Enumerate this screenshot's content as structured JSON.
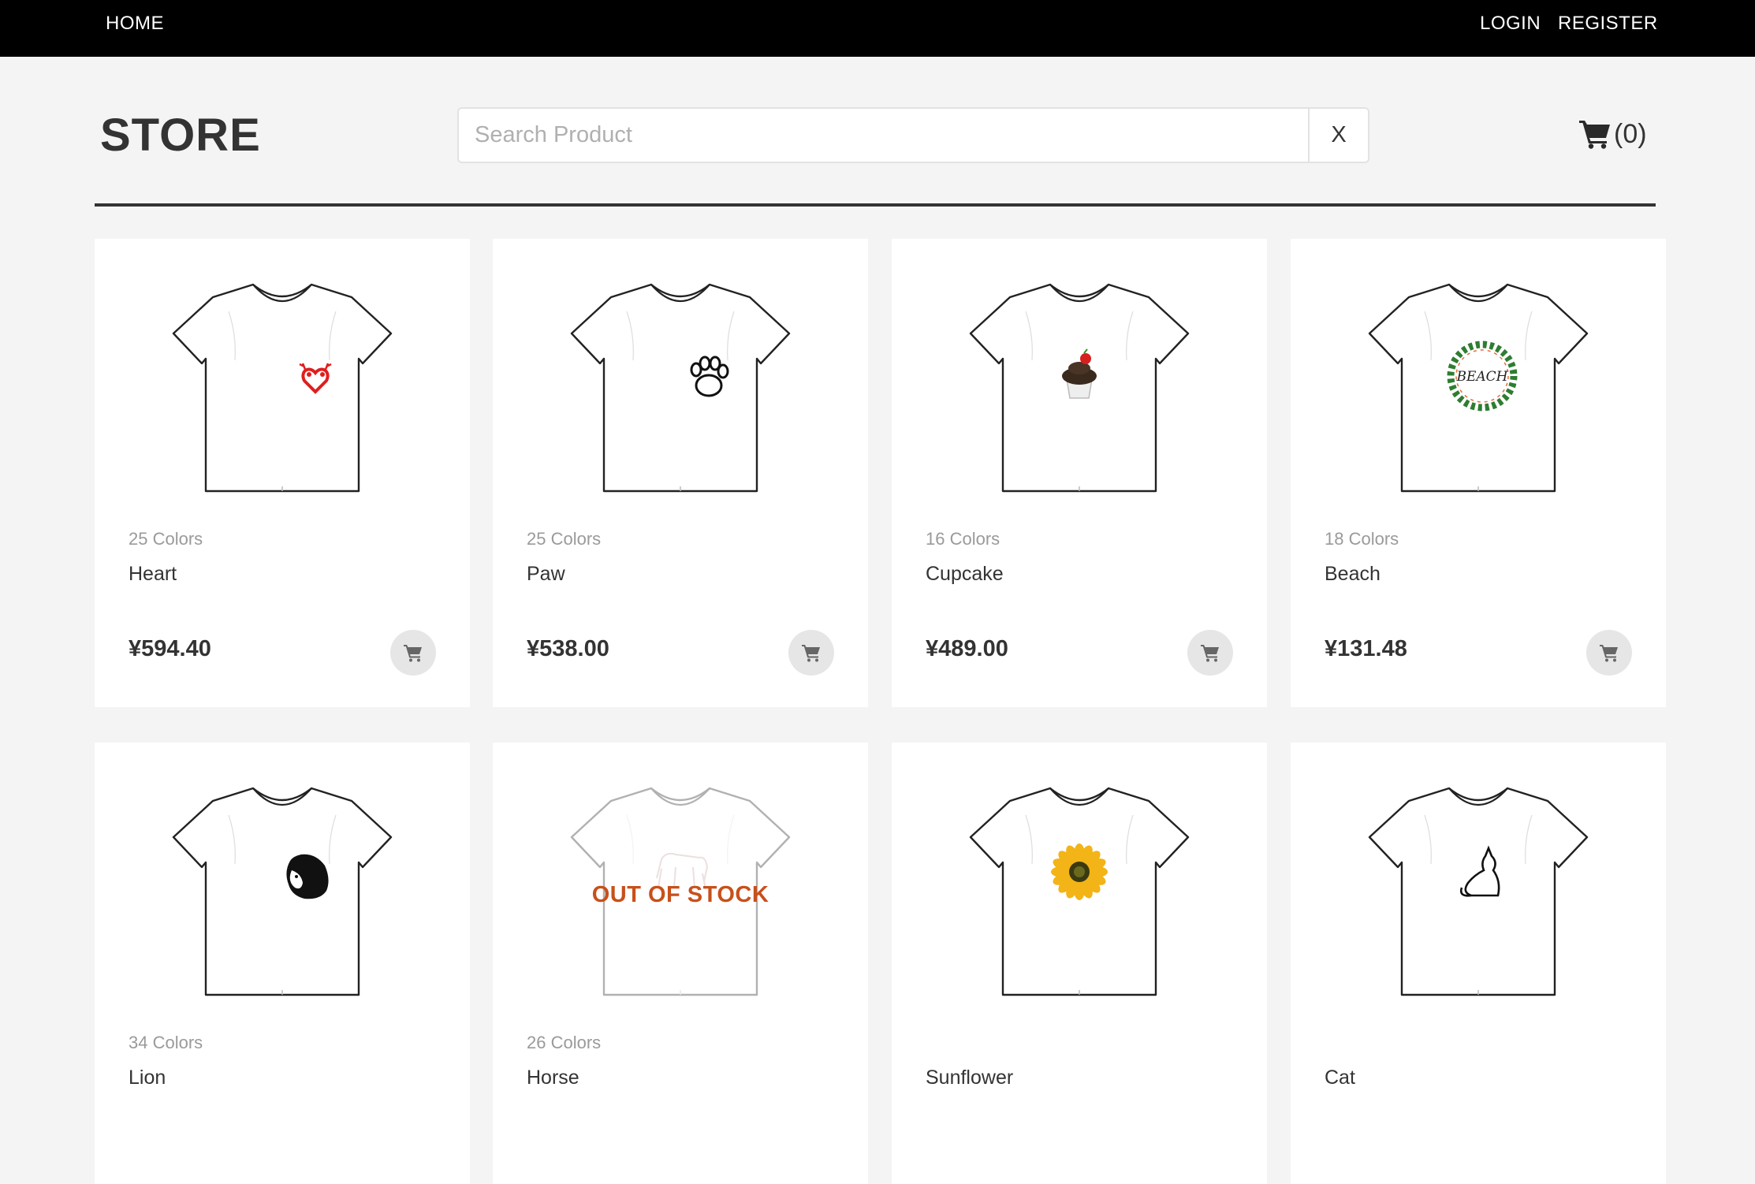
{
  "nav": {
    "home": "HOME",
    "login": "LOGIN",
    "register": "REGISTER"
  },
  "header": {
    "title": "STORE",
    "search_placeholder": "Search Product",
    "search_value": "",
    "clear_label": "X",
    "cart_count": "(0)"
  },
  "products": [
    {
      "colors": "25 Colors",
      "name": "Heart",
      "price": "¥594.40",
      "design": "heart-deer-icon",
      "in_stock": true
    },
    {
      "colors": "25 Colors",
      "name": "Paw",
      "price": "¥538.00",
      "design": "paw-icon",
      "in_stock": true
    },
    {
      "colors": "16 Colors",
      "name": "Cupcake",
      "price": "¥489.00",
      "design": "cupcake-icon",
      "in_stock": true
    },
    {
      "colors": "18 Colors",
      "name": "Beach",
      "price": "¥131.48",
      "design": "beach-wreath-icon",
      "design_text": "BEACH",
      "in_stock": true
    },
    {
      "colors": "34 Colors",
      "name": "Lion",
      "price": "",
      "design": "lion-icon",
      "in_stock": true
    },
    {
      "colors": "26 Colors",
      "name": "Horse",
      "price": "",
      "design": "horse-icon",
      "in_stock": false,
      "stock_label": "OUT OF STOCK"
    },
    {
      "colors": "",
      "name": "Sunflower",
      "price": "",
      "design": "sunflower-icon",
      "in_stock": true
    },
    {
      "colors": "",
      "name": "Cat",
      "price": "",
      "design": "cat-icon",
      "in_stock": true
    }
  ],
  "colors": {
    "topbar": "#000000",
    "background": "#f4f4f4",
    "out_of_stock": "#c8501a",
    "heart_design": "#e01e1e"
  }
}
